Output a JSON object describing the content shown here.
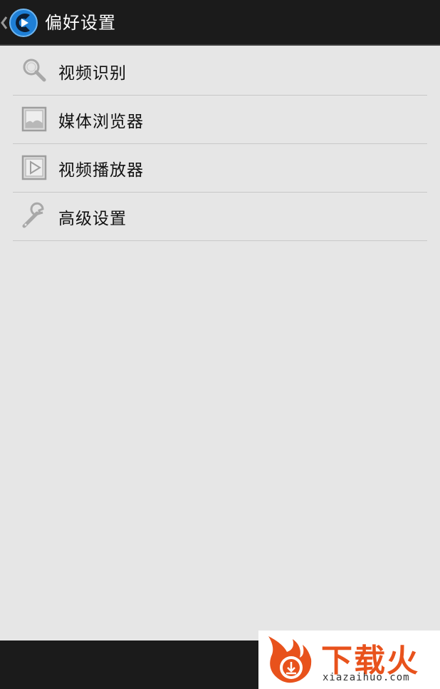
{
  "header": {
    "title": "偏好设置",
    "back_icon": "chevron-left-icon",
    "logo_icon": "app-logo-icon"
  },
  "menu": {
    "items": [
      {
        "label": "视频识别",
        "icon": "search-icon"
      },
      {
        "label": "媒体浏览器",
        "icon": "image-icon"
      },
      {
        "label": "视频播放器",
        "icon": "play-icon"
      },
      {
        "label": "高级设置",
        "icon": "wrench-icon"
      }
    ]
  },
  "watermark": {
    "brand": "下载火",
    "site": "xiazaihuo.com"
  },
  "colors": {
    "background": "#e6e6e6",
    "topbar": "#1b1b1b",
    "logo_blue": "#1e7fd6",
    "watermark_orange": "#e8521c"
  }
}
